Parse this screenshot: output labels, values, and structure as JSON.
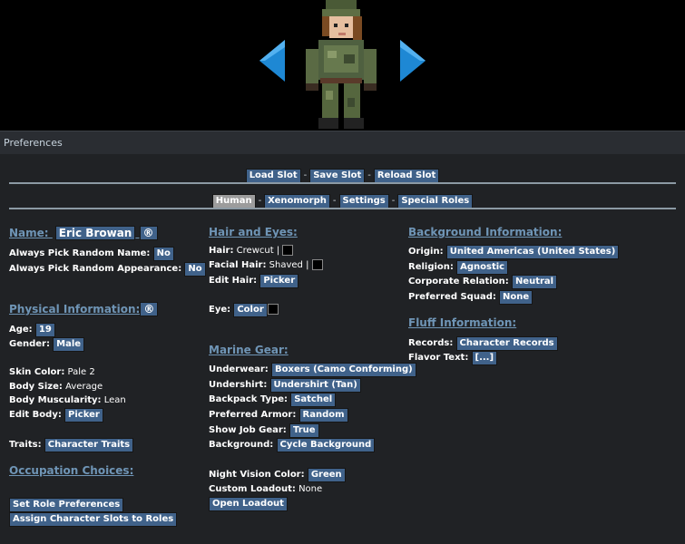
{
  "window": {
    "title": "Preferences"
  },
  "slots": {
    "load": "Load Slot",
    "save": "Save Slot",
    "reload": "Reload Slot",
    "sep": "-"
  },
  "tabs": [
    {
      "label": "Human",
      "selected": true
    },
    {
      "label": "Xenomorph"
    },
    {
      "label": "Settings"
    },
    {
      "label": "Special Roles"
    }
  ],
  "name": {
    "heading": "Name:",
    "value": "Eric Browan",
    "random_icon": "®",
    "random_name_label": "Always Pick Random Name:",
    "random_name_value": "No",
    "random_appearance_label": "Always Pick Random Appearance:",
    "random_appearance_value": "No"
  },
  "physical": {
    "heading": "Physical Information:",
    "random_icon": "®",
    "age_label": "Age:",
    "age_value": "19",
    "gender_label": "Gender:",
    "gender_value": "Male",
    "skin_label": "Skin Color:",
    "skin_value": "Pale 2",
    "size_label": "Body Size:",
    "size_value": "Average",
    "musc_label": "Body Muscularity:",
    "musc_value": "Lean",
    "edit_label": "Edit Body:",
    "edit_value": "Picker",
    "traits_label": "Traits:",
    "traits_value": "Character Traits"
  },
  "occupation": {
    "heading": "Occupation Choices:",
    "set_roles": "Set Role Preferences",
    "assign_slots": "Assign Character Slots to Roles"
  },
  "hair": {
    "heading": "Hair and Eyes:",
    "hair_label": "Hair:",
    "hair_value": "Crewcut |",
    "facial_label": "Facial Hair:",
    "facial_value": "Shaved |",
    "edit_label": "Edit Hair:",
    "edit_value": "Picker",
    "eye_label": "Eye:",
    "eye_value": "Color"
  },
  "gear": {
    "heading": "Marine Gear:",
    "underwear_label": "Underwear:",
    "underwear_value": "Boxers (Camo Conforming)",
    "undershirt_label": "Undershirt:",
    "undershirt_value": "Undershirt (Tan)",
    "backpack_label": "Backpack Type:",
    "backpack_value": "Satchel",
    "armor_label": "Preferred Armor:",
    "armor_value": "Random",
    "jobgear_label": "Show Job Gear:",
    "jobgear_value": "True",
    "background_label": "Background:",
    "background_value": "Cycle Background",
    "nv_label": "Night Vision Color:",
    "nv_value": "Green",
    "loadout_label": "Custom Loadout:",
    "loadout_value": "None",
    "open_loadout": "Open Loadout"
  },
  "bginfo": {
    "heading": "Background Information:",
    "origin_label": "Origin:",
    "origin_value": "United Americas (United States)",
    "religion_label": "Religion:",
    "religion_value": "Agnostic",
    "corp_label": "Corporate Relation:",
    "corp_value": "Neutral",
    "squad_label": "Preferred Squad:",
    "squad_value": "None"
  },
  "fluff": {
    "heading": "Fluff Information:",
    "records_label": "Records:",
    "records_value": "Character Records",
    "flavor_label": "Flavor Text:",
    "flavor_value": "[...]"
  },
  "colors": {
    "button": "#40628a",
    "heading": "#6f95b6",
    "panel": "#202225",
    "arrow": "#1e88d4"
  }
}
